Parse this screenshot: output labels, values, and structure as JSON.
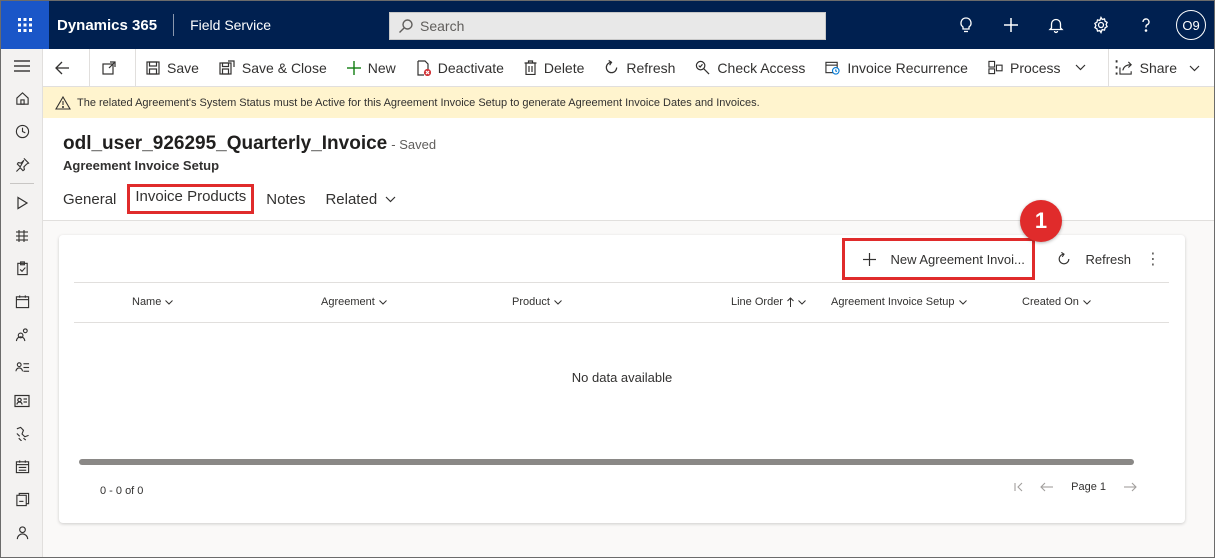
{
  "topbar": {
    "brand": "Dynamics 365",
    "app_name": "Field Service",
    "search_placeholder": "Search",
    "avatar_initials": "O9",
    "icons": [
      "lightbulb-icon",
      "plus-icon",
      "bell-icon",
      "gear-icon",
      "help-icon"
    ]
  },
  "commandbar": {
    "save": "Save",
    "save_close": "Save & Close",
    "new": "New",
    "deactivate": "Deactivate",
    "delete": "Delete",
    "refresh": "Refresh",
    "check_access": "Check Access",
    "invoice_recurrence": "Invoice Recurrence",
    "process": "Process",
    "share": "Share"
  },
  "warning": {
    "text": "The related Agreement's System Status must be Active for this Agreement Invoice Setup to generate Agreement Invoice Dates and Invoices."
  },
  "record": {
    "title": "odl_user_926295_Quarterly_Invoice",
    "status": "- Saved",
    "entity": "Agreement Invoice Setup"
  },
  "tabs": [
    "General",
    "Invoice Products",
    "Notes",
    "Related"
  ],
  "grid": {
    "new_button": "New Agreement Invoi...",
    "refresh": "Refresh",
    "columns": [
      "Name",
      "Agreement",
      "Product",
      "Line Order",
      "Agreement Invoice Setup",
      "Created On"
    ],
    "empty_text": "No data available",
    "count_text": "0 - 0 of 0",
    "page_text": "Page 1"
  },
  "annotation": {
    "step": "1"
  },
  "colors": {
    "nav": "#002050",
    "waffle": "#1a56c8",
    "highlight": "#e02b2b",
    "warning_bg": "#fff4ce"
  }
}
